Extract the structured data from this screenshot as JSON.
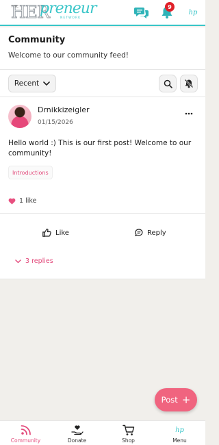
{
  "brand": {
    "logo_the": "THE",
    "logo_her": "HER",
    "logo_script": "preneur",
    "logo_network": "NETWORK",
    "mini_logo": "hp",
    "accent": "#39c5c8",
    "pink": "#f0647f"
  },
  "header_icons": {
    "chat_icon": "chat-bubbles-icon",
    "bell_icon": "bell-icon",
    "notification_count": "9"
  },
  "page": {
    "title": "Community",
    "subtitle": "Welcome to our community feed!"
  },
  "filters": {
    "sort_label": "Recent",
    "search_icon": "search-icon",
    "mute_icon": "bell-off-icon"
  },
  "post": {
    "author": "Drnikkizeigler",
    "date": "01/15/2026",
    "body": "Hello world :) This is our first post! Welcome to our community!",
    "tag": "Introductions",
    "likes_text": "1 like",
    "like_label": "Like",
    "reply_label": "Reply",
    "replies_label": "3 replies"
  },
  "fab": {
    "label": "Post",
    "plus": "+"
  },
  "nav": {
    "items": [
      {
        "label": "Community",
        "icon": "rss-icon"
      },
      {
        "label": "Donate",
        "icon": "heart-hand-icon"
      },
      {
        "label": "Shop",
        "icon": "cart-icon"
      },
      {
        "label": "Menu",
        "icon": "brand-menu-icon"
      }
    ]
  }
}
